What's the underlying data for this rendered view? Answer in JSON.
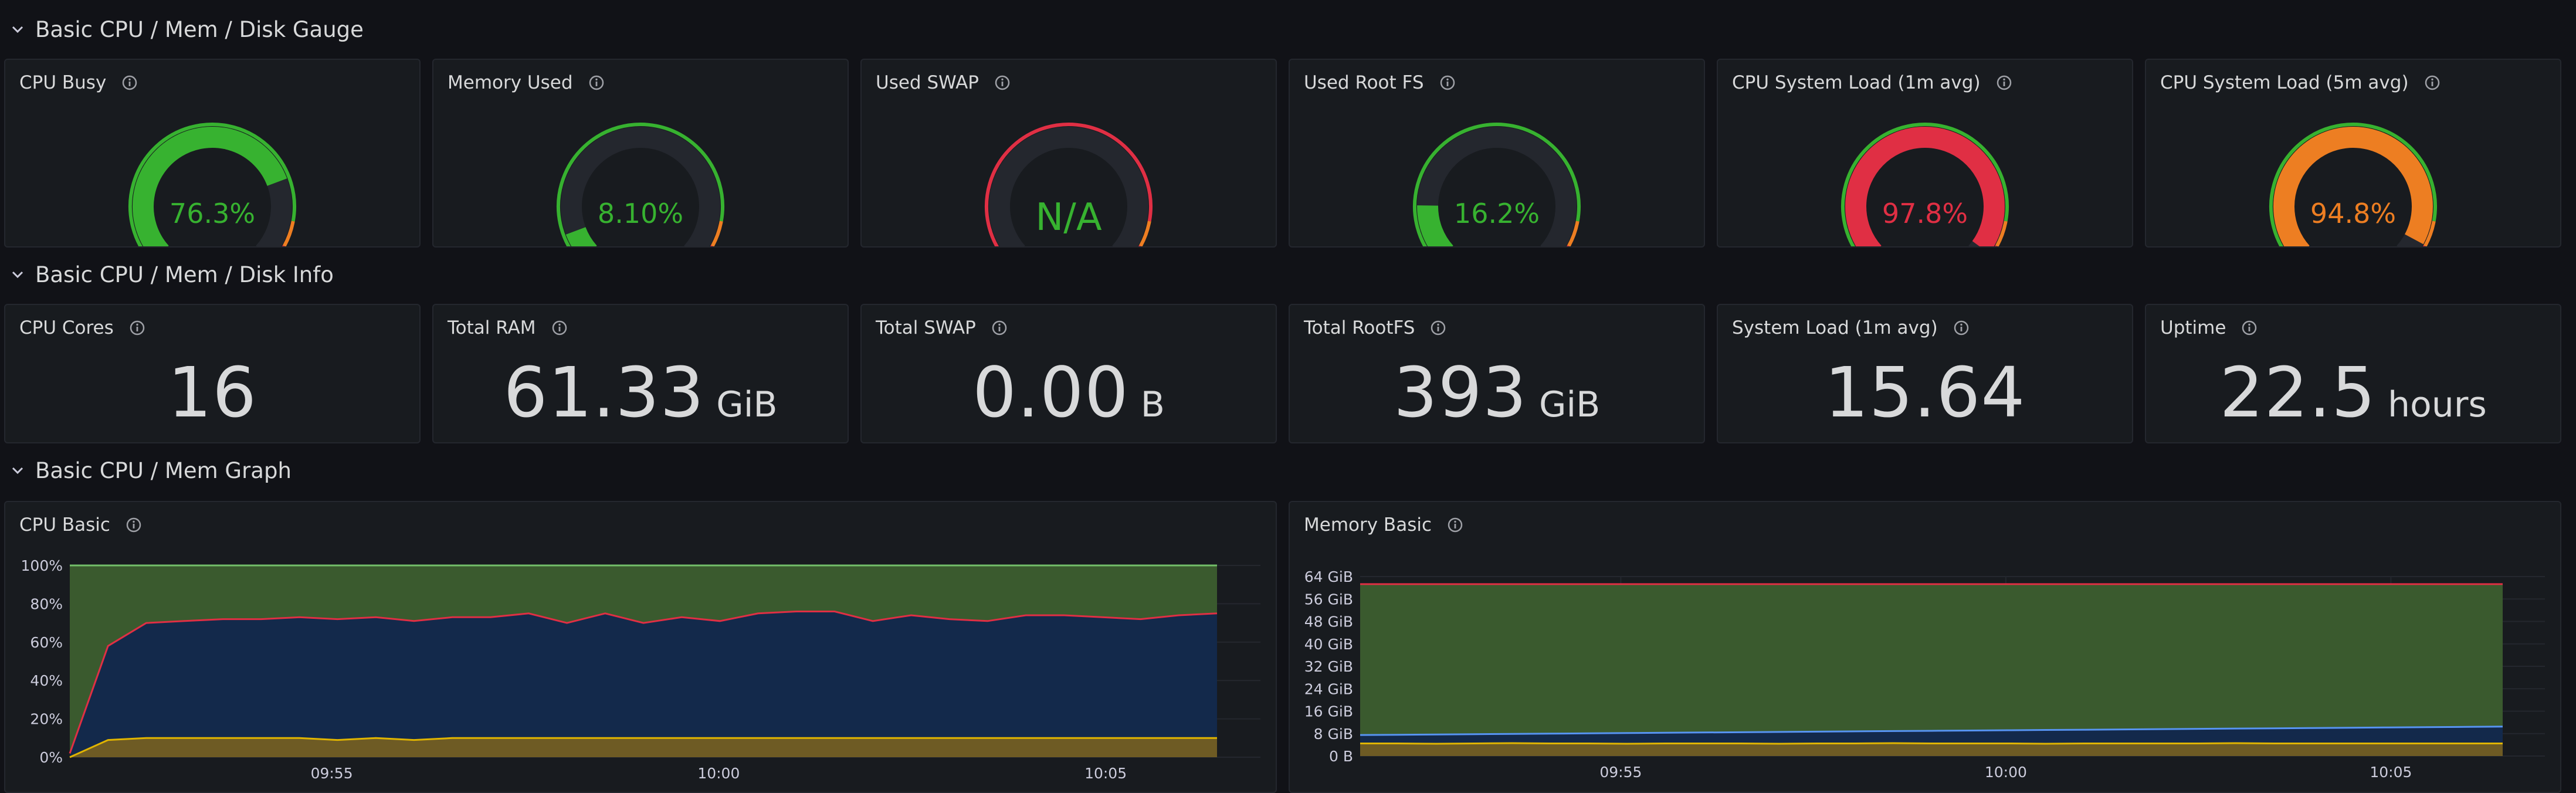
{
  "rows": [
    {
      "title": "Basic CPU / Mem / Disk Gauge"
    },
    {
      "title": "Basic CPU / Mem / Disk Info"
    },
    {
      "title": "Basic CPU / Mem Graph"
    }
  ],
  "gauges": [
    {
      "title": "CPU Busy",
      "display": "76.3%",
      "fraction": 0.763,
      "value_color": "#37b230",
      "fill_color": "#37b230",
      "threshold_color": "#37b230"
    },
    {
      "title": "Memory Used",
      "display": "8.10%",
      "fraction": 0.081,
      "value_color": "#37b230",
      "fill_color": "#37b230",
      "threshold_color": "#37b230"
    },
    {
      "title": "Used SWAP",
      "display": "N/A",
      "fraction": 0,
      "value_color": "#37b230",
      "fill_color": "#37b230",
      "threshold_color": "#e02f44"
    },
    {
      "title": "Used Root FS",
      "display": "16.2%",
      "fraction": 0.162,
      "value_color": "#37b230",
      "fill_color": "#37b230",
      "threshold_color": "#37b230"
    },
    {
      "title": "CPU System Load (1m avg)",
      "display": "97.8%",
      "fraction": 0.978,
      "value_color": "#e02f44",
      "fill_color": "#e02f44",
      "threshold_color": "#37b230"
    },
    {
      "title": "CPU System Load (5m avg)",
      "display": "94.8%",
      "fraction": 0.948,
      "value_color": "#ed7e22",
      "fill_color": "#ed7e22",
      "threshold_color": "#37b230"
    }
  ],
  "stats": [
    {
      "title": "CPU Cores",
      "value": "16",
      "unit": ""
    },
    {
      "title": "Total RAM",
      "value": "61.33",
      "unit": "GiB"
    },
    {
      "title": "Total SWAP",
      "value": "0.00",
      "unit": "B"
    },
    {
      "title": "Total RootFS",
      "value": "393",
      "unit": "GiB"
    },
    {
      "title": "System Load (1m avg)",
      "value": "15.64",
      "unit": ""
    },
    {
      "title": "Uptime",
      "value": "22.5",
      "unit": "hours"
    }
  ],
  "cpu_panel": {
    "title": "CPU Basic"
  },
  "mem_panel": {
    "title": "Memory Basic"
  },
  "chart_data": [
    {
      "type": "area",
      "title": "CPU Basic",
      "ylim": [
        0,
        100
      ],
      "yticks": [
        "0%",
        "20%",
        "40%",
        "60%",
        "80%",
        "100%"
      ],
      "xticks": [
        {
          "label": "09:55",
          "x": 0.22
        },
        {
          "label": "10:00",
          "x": 0.545
        },
        {
          "label": "10:05",
          "x": 0.87
        }
      ],
      "grid": true,
      "series": [
        {
          "color": "#3a5a2e",
          "stroke": "#73bf69",
          "values": [
            100,
            100,
            100,
            100,
            100,
            100,
            100,
            100,
            100,
            100,
            100,
            100,
            100,
            100,
            100,
            100,
            100,
            100,
            100,
            100,
            100,
            100,
            100,
            100,
            100,
            100,
            100,
            100,
            100,
            100,
            100
          ]
        },
        {
          "color": "#13294b",
          "stroke": "#e02f44",
          "values": [
            2,
            58,
            70,
            71,
            72,
            72,
            73,
            72,
            73,
            71,
            73,
            73,
            75,
            70,
            75,
            70,
            73,
            71,
            75,
            76,
            76,
            71,
            74,
            72,
            71,
            74,
            74,
            73,
            72,
            74,
            75
          ]
        },
        {
          "color": "#6e5b24",
          "stroke": "#e0b400",
          "values": [
            0,
            9,
            10,
            10,
            10,
            10,
            10,
            9,
            10,
            9,
            10,
            10,
            10,
            10,
            10,
            10,
            10,
            10,
            10,
            10,
            10,
            10,
            10,
            10,
            10,
            10,
            10,
            10,
            10,
            10,
            10
          ]
        }
      ]
    },
    {
      "type": "area",
      "title": "Memory Basic",
      "ylim": [
        0,
        64
      ],
      "yticks": [
        "0 B",
        "8 GiB",
        "16 GiB",
        "24 GiB",
        "32 GiB",
        "40 GiB",
        "48 GiB",
        "56 GiB",
        "64 GiB"
      ],
      "xticks": [
        {
          "label": "09:55",
          "x": 0.22
        },
        {
          "label": "10:00",
          "x": 0.545
        },
        {
          "label": "10:05",
          "x": 0.87
        }
      ],
      "grid": true,
      "series": [
        {
          "color": "#3a5a2e",
          "stroke": "#e02f44",
          "values": [
            61.3,
            61.3,
            61.3,
            61.3,
            61.3,
            61.3,
            61.3,
            61.3,
            61.3,
            61.3,
            61.3,
            61.3,
            61.3,
            61.3,
            61.3,
            61.3,
            61.3,
            61.3,
            61.3,
            61.3,
            61.3,
            61.3,
            61.3,
            61.3,
            61.3,
            61.3,
            61.3,
            61.3,
            61.3,
            61.3,
            61.3
          ]
        },
        {
          "color": "#13294b",
          "stroke": "#5794f2",
          "values": [
            7.5,
            7.6,
            7.7,
            7.8,
            7.9,
            8.0,
            8.1,
            8.2,
            8.3,
            8.4,
            8.5,
            8.6,
            8.7,
            8.8,
            8.9,
            9.0,
            9.1,
            9.2,
            9.3,
            9.4,
            9.5,
            9.6,
            9.7,
            9.8,
            9.9,
            10.0,
            10.1,
            10.2,
            10.3,
            10.4,
            10.5
          ]
        },
        {
          "color": "#6e5b24",
          "stroke": "#e0b400",
          "values": [
            4.5,
            4.5,
            4.4,
            4.5,
            4.6,
            4.5,
            4.5,
            4.4,
            4.5,
            4.5,
            4.5,
            4.4,
            4.5,
            4.5,
            4.6,
            4.5,
            4.5,
            4.5,
            4.4,
            4.5,
            4.5,
            4.5,
            4.5,
            4.6,
            4.5,
            4.5,
            4.5,
            4.5,
            4.5,
            4.5,
            4.5
          ]
        }
      ]
    }
  ]
}
